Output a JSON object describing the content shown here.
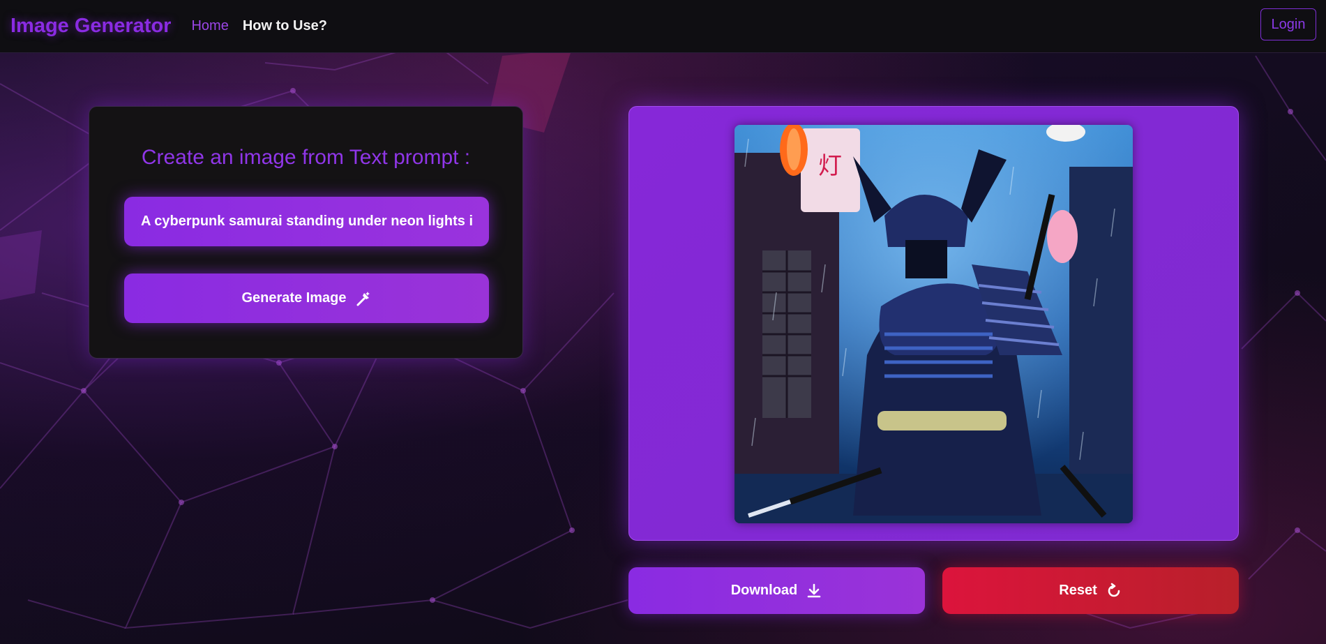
{
  "navbar": {
    "brand": "Image Generator",
    "links": [
      {
        "label": "Home"
      },
      {
        "label": "How to Use?"
      }
    ],
    "login_label": "Login"
  },
  "prompt_card": {
    "title": "Create an image from Text prompt :",
    "input_value": "A cyberpunk samurai standing under neon lights in the rain",
    "generate_label": "Generate Image",
    "generate_icon": "magic-wand-icon"
  },
  "image_panel": {
    "image_subject": "cyberpunk samurai in rainy neon alley"
  },
  "actions": {
    "download_label": "Download",
    "download_icon": "download-icon",
    "reset_label": "Reset",
    "reset_icon": "refresh-icon"
  },
  "colors": {
    "accent": "#8a2be2",
    "reset": "#dc143c",
    "background": "#0f0c16"
  }
}
